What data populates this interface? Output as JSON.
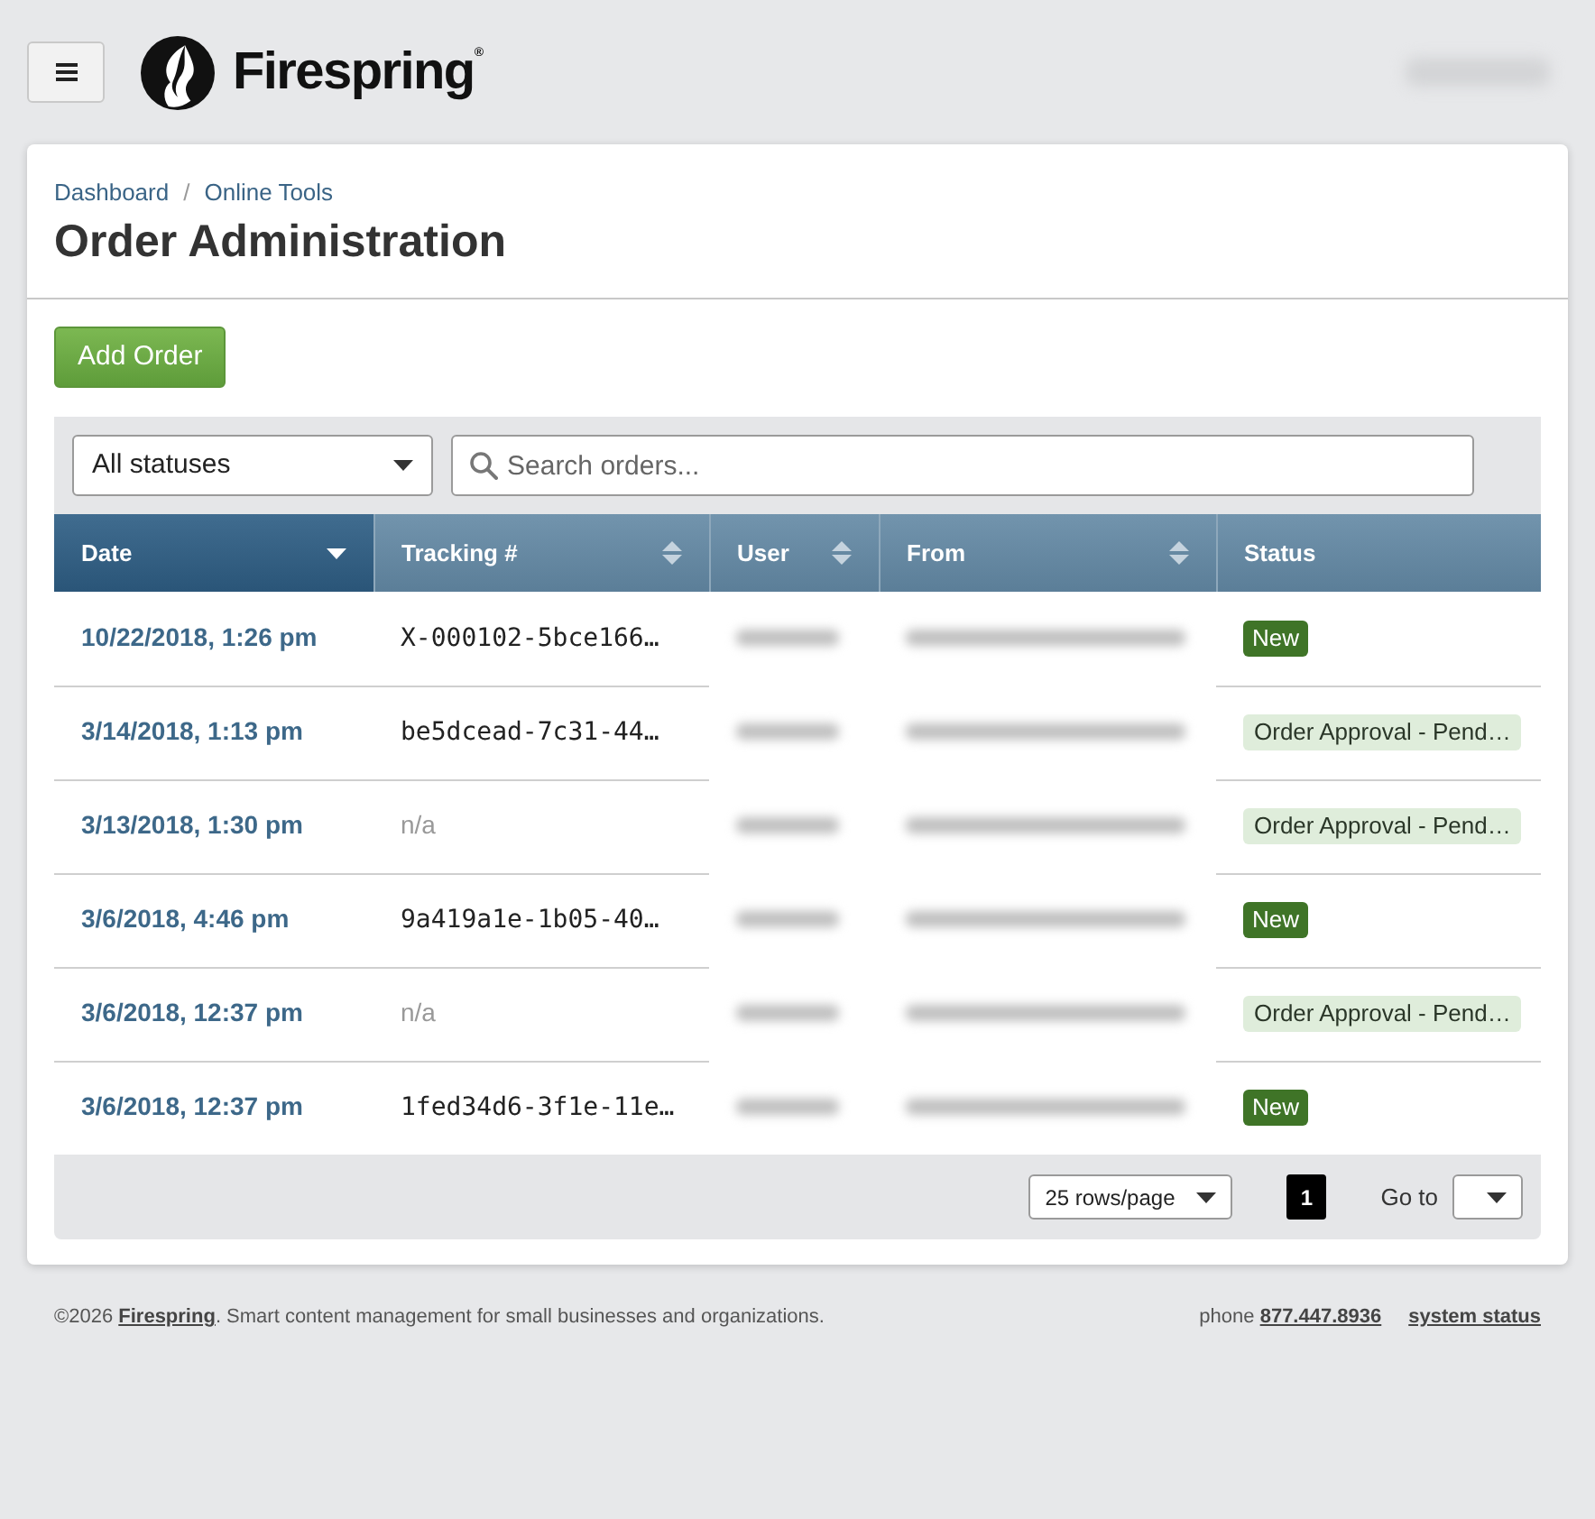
{
  "header": {
    "brand": "Firespring$^{®}$"
  },
  "breadcrumb": {
    "items": [
      {
        "label": "Dashboard"
      },
      {
        "label": "Online Tools"
      }
    ],
    "separator": "/"
  },
  "title": "Order Administration",
  "add_button": "Add Order",
  "filters": {
    "status_select": "All statuses",
    "search": {
      "placeholder": "Search orders..."
    }
  },
  "table": {
    "columns": [
      {
        "label": "Date",
        "sortable": true,
        "sorted": true
      },
      {
        "label": "Tracking #",
        "sortable": true,
        "sorted": false
      },
      {
        "label": "User",
        "sortable": true,
        "sorted": false
      },
      {
        "label": "From",
        "sortable": true,
        "sorted": false
      },
      {
        "label": "Status",
        "sortable": false,
        "sorted": false
      }
    ],
    "rows": [
      {
        "cells": [
          {
            "kind": "link",
            "text": "10/22/2018, 1:26 pm"
          },
          {
            "kind": "code",
            "text": "X-000102-5bce166…"
          },
          {
            "kind": "redacted"
          },
          {
            "kind": "redacted"
          },
          {
            "kind": "status-new",
            "text": "New"
          }
        ]
      },
      {
        "cells": [
          {
            "kind": "link",
            "text": "3/14/2018, 1:13 pm"
          },
          {
            "kind": "code",
            "text": "be5dcead-7c31-44…"
          },
          {
            "kind": "redacted"
          },
          {
            "kind": "redacted"
          },
          {
            "kind": "status-pending",
            "text": "Order Approval - Pend…"
          }
        ]
      },
      {
        "cells": [
          {
            "kind": "link",
            "text": "3/13/2018, 1:30 pm"
          },
          {
            "kind": "muted",
            "text": "n/a"
          },
          {
            "kind": "redacted"
          },
          {
            "kind": "redacted"
          },
          {
            "kind": "status-pending",
            "text": "Order Approval - Pend…"
          }
        ]
      },
      {
        "cells": [
          {
            "kind": "link",
            "text": "3/6/2018, 4:46 pm"
          },
          {
            "kind": "code",
            "text": "9a419a1e-1b05-40…"
          },
          {
            "kind": "redacted"
          },
          {
            "kind": "redacted"
          },
          {
            "kind": "status-new",
            "text": "New"
          }
        ]
      },
      {
        "cells": [
          {
            "kind": "link",
            "text": "3/6/2018, 12:37 pm"
          },
          {
            "kind": "muted",
            "text": "n/a"
          },
          {
            "kind": "redacted"
          },
          {
            "kind": "redacted"
          },
          {
            "kind": "status-pending",
            "text": "Order Approval - Pend…"
          }
        ]
      },
      {
        "cells": [
          {
            "kind": "link",
            "text": "3/6/2018, 12:37 pm"
          },
          {
            "kind": "code",
            "text": "1fed34d6-3f1e-11e…"
          },
          {
            "kind": "redacted"
          },
          {
            "kind": "redacted"
          },
          {
            "kind": "status-new",
            "text": "New"
          }
        ]
      }
    ]
  },
  "pager": {
    "rows_per_page": "25 rows/page",
    "pages": [
      {
        "label": "1",
        "selected": true
      }
    ],
    "goto_label": "Go to"
  },
  "footer": {
    "copyright": "©2026",
    "brand_link": "Firespring",
    "tagline": ". Smart content management for small businesses and organizations.",
    "phone_label": "phone",
    "phone": "877.447.8936",
    "status_link": "system status"
  }
}
